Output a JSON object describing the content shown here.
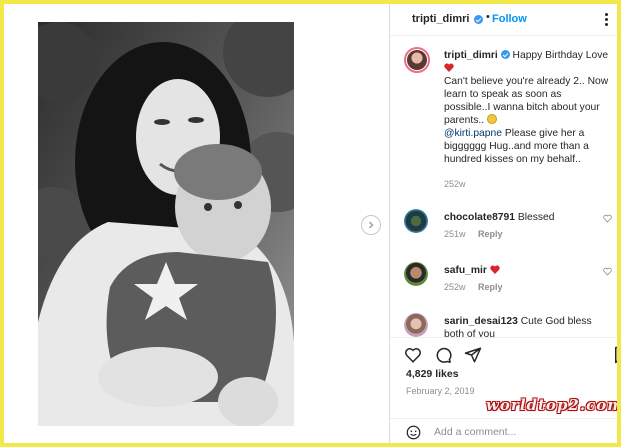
{
  "header": {
    "username": "tripti_dimri",
    "separator": "•",
    "follow_label": "Follow"
  },
  "caption": {
    "username": "tripti_dimri",
    "line1": "Happy Birthday Love",
    "line2": "Can't believe you're already 2.. Now learn to speak as soon as possible..I wanna bitch about your parents..",
    "mention": "@kirti.papne",
    "line3": " Please give her a bigggggg Hug..and more than a hundred kisses on my behalf..",
    "time": "252w"
  },
  "comments": [
    {
      "username": "chocolate8791",
      "text": "Blessed",
      "time": "251w",
      "reply_label": "Reply",
      "icon": "heart-emoji-icon"
    },
    {
      "username": "safu_mir",
      "text": "",
      "time": "252w",
      "reply_label": "Reply",
      "icon": "heart-emoji-icon"
    },
    {
      "username": "sarin_desai123",
      "text": "Cute God bless both of you",
      "time": "",
      "reply_label": ""
    }
  ],
  "actions": {
    "likes": "4,829 likes",
    "date": "February 2, 2019",
    "watermark": "worldtop2.com"
  },
  "add_comment": {
    "placeholder": "Add a comment..."
  },
  "colors": {
    "accent": "#0095f6",
    "verified": "#3897f0",
    "heart": "#ed4956",
    "page_border": "#f2e84a"
  }
}
